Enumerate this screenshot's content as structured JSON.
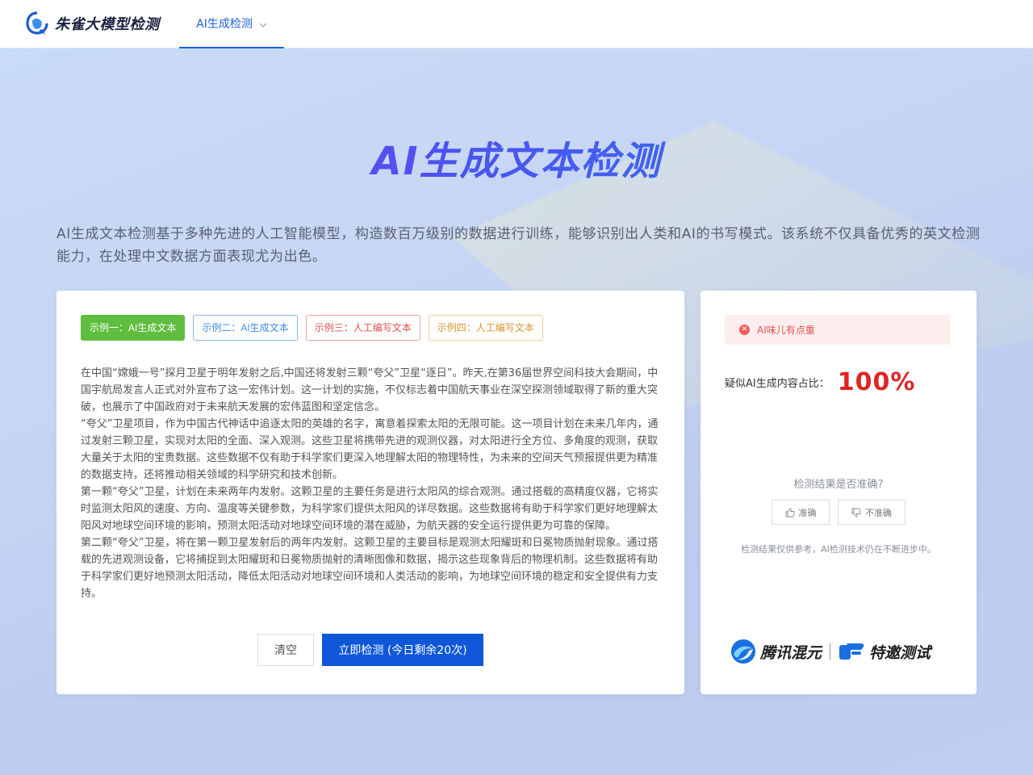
{
  "brand": {
    "name": "朱雀大模型检测"
  },
  "nav": {
    "tab_label": "AI生成检测"
  },
  "hero": {
    "title": "AI生成文本检测",
    "description": "AI生成文本检测基于多种先进的人工智能模型，构造数百万级别的数据进行训练，能够识别出人类和AI的书写模式。该系统不仅具备优秀的英文检测能力，在处理中文数据方面表现尤为出色。"
  },
  "examples": [
    {
      "label": "示例一：AI生成文本"
    },
    {
      "label": "示例二：AI生成文本"
    },
    {
      "label": "示例三：人工编写文本"
    },
    {
      "label": "示例四：人工编写文本"
    }
  ],
  "input_text": [
    "在中国“嫦娥一号”探月卫星于明年发射之后,中国还将发射三颗“夸父”卫星“逐日”。昨天,在第36届世界空间科技大会期间，中国宇航局发言人正式对外宣布了这一宏伟计划。这一计划的实施，不仅标志着中国航天事业在深空探测领域取得了新的重大突破，也展示了中国政府对于未来航天发展的宏伟蓝图和坚定信念。",
    "“夸父”卫星项目，作为中国古代神话中追逐太阳的英雄的名字，寓意着探索太阳的无限可能。这一项目计划在未来几年内，通过发射三颗卫星，实现对太阳的全面、深入观测。这些卫星将携带先进的观测仪器，对太阳进行全方位、多角度的观测，获取大量关于太阳的宝贵数据。这些数据不仅有助于科学家们更深入地理解太阳的物理特性，为未来的空间天气预报提供更为精准的数据支持，还将推动相关领域的科学研究和技术创新。",
    "第一颗“夸父”卫星，计划在未来两年内发射。这颗卫星的主要任务是进行太阳风的综合观测。通过搭载的高精度仪器，它将实时监测太阳风的速度、方向、温度等关键参数，为科学家们提供太阳风的详尽数据。这些数据将有助于科学家们更好地理解太阳风对地球空间环境的影响，预测太阳活动对地球空间环境的潜在威胁，为航天器的安全运行提供更为可靠的保障。",
    "第二颗“夸父”卫星，将在第一颗卫星发射后的两年内发射。这颗卫星的主要目标是观测太阳耀斑和日冕物质抛射现象。通过搭载的先进观测设备，它将捕捉到太阳耀斑和日冕物质抛射的清晰图像和数据，揭示这些现象背后的物理机制。这些数据将有助于科学家们更好地预测太阳活动，降低太阳活动对地球空间环境和人类活动的影响，为地球空间环境的稳定和安全提供有力支持。"
  ],
  "actions": {
    "clear_label": "清空",
    "detect_label": "立即检测 (今日剩余20次)"
  },
  "result": {
    "alert_text": "AI味儿有点重",
    "ratio_label": "疑似AI生成内容占比：",
    "ratio_value": "100%",
    "feedback_question": "检测结果是否准确?",
    "accurate_label": "准确",
    "inaccurate_label": "不准确",
    "disclaimer": "检测结果仅供参考，AI检测技术仍在不断进步中。"
  },
  "partners": {
    "hunyuan": "腾讯混元",
    "invite": "特邀测试"
  },
  "colors": {
    "primary": "#0f57d8",
    "danger": "#e02424",
    "success": "#5fbd3f"
  }
}
